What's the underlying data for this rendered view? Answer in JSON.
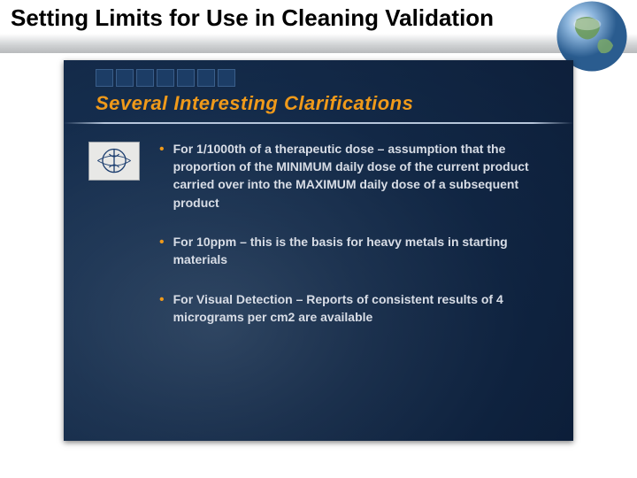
{
  "outer": {
    "title": "Setting Limits for Use in Cleaning Validation"
  },
  "inner": {
    "heading": "Several Interesting Clarifications",
    "squares_count": 7,
    "bullets": [
      "For 1/1000th of a therapeutic dose – assumption that the proportion of the MINIMUM daily dose of the current product carried over into the MAXIMUM daily dose of a subsequent product",
      "For 10ppm – this is the basis for heavy metals in starting materials",
      "For Visual Detection – Reports of consistent results of 4 micrograms per cm2 are available"
    ]
  },
  "icons": {
    "globe": "globe-icon",
    "who": "who-logo"
  }
}
